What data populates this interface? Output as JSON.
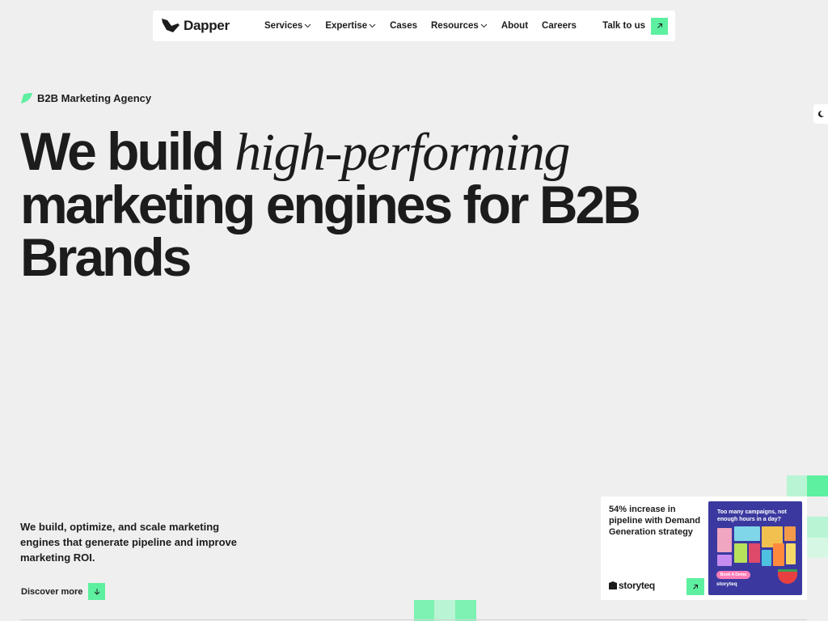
{
  "nav": {
    "logo_text": "Dapper",
    "items": [
      {
        "label": "Services",
        "dropdown": true
      },
      {
        "label": "Expertise",
        "dropdown": true
      },
      {
        "label": "Cases",
        "dropdown": false
      },
      {
        "label": "Resources",
        "dropdown": true
      },
      {
        "label": "About",
        "dropdown": false
      },
      {
        "label": "Careers",
        "dropdown": false
      }
    ],
    "cta_label": "Talk to us"
  },
  "hero": {
    "badge": "B2B Marketing Agency",
    "headline_part1": "We build ",
    "headline_italic": "high-performing",
    "headline_part2": "marketing engines for B2B Brands",
    "subtext": "We build, optimize, and scale marketing engines that generate pipeline and improve marketing ROI.",
    "discover_label": "Discover more"
  },
  "case_card": {
    "title": "54% increase in pipeline with Demand Generation strategy",
    "brand": "storyteq",
    "ad": {
      "headline": "Too many campaigns, not enough hours in a day?",
      "button": "Book A Demo",
      "logo": "storyteq"
    }
  },
  "colors": {
    "accent": "#5df0a0",
    "background": "#efefef",
    "text": "#1c1c1c",
    "ad_background": "#3b39a0"
  },
  "icons": {
    "logo": "dapper-bird-icon",
    "chevron": "chevron-down-icon",
    "cta_arrow": "arrow-up-right-icon",
    "discover_arrow": "arrow-down-icon",
    "theme": "moon-icon",
    "badge": "leaf-icon"
  }
}
